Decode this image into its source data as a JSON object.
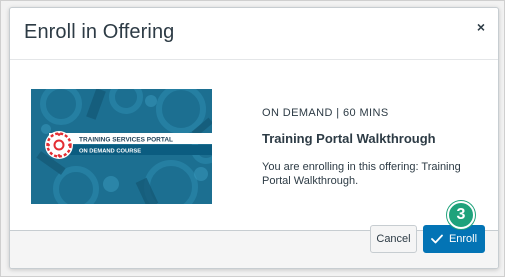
{
  "modal": {
    "title": "Enroll in Offering",
    "close_symbol": "×"
  },
  "course": {
    "meta": "ON DEMAND | 60 MINS",
    "title": "Training Portal Walkthrough",
    "message": "You are enrolling in this offering: Training Portal Walkthrough.",
    "image": {
      "banner_title": "TRAINING SERVICES PORTAL",
      "banner_subtitle": "ON DEMAND COURSE",
      "accent_color": "#e32d33",
      "background_color": "#1c6f91"
    }
  },
  "footer": {
    "cancel_label": "Cancel",
    "enroll_label": "Enroll"
  },
  "callout": {
    "step_number": "3",
    "color": "#1ea27b"
  },
  "colors": {
    "primary_button": "#0374b5",
    "text": "#2d3b45"
  }
}
